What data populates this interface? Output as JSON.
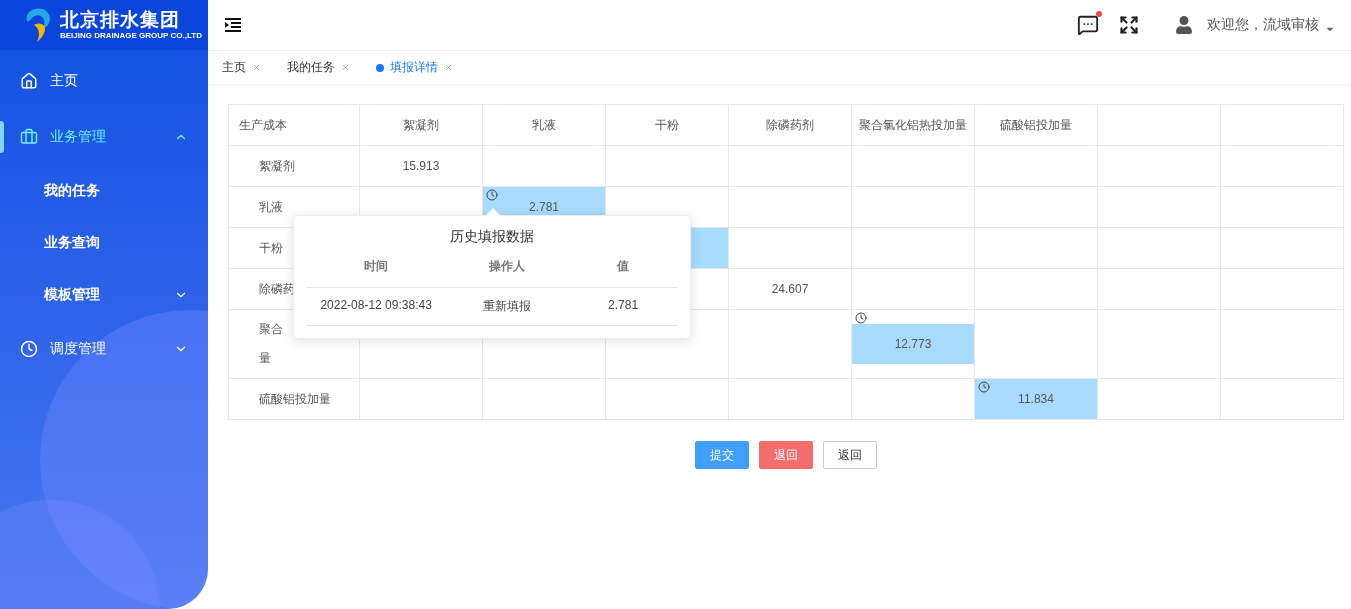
{
  "logo": {
    "name": "北京排水集团",
    "subtitle": "BEIJING DRAINAGE GROUP CO.,LTD"
  },
  "sidebar": {
    "items": [
      {
        "label": "主页",
        "kind": "home",
        "selected": false
      },
      {
        "label": "业务管理",
        "kind": "briefcase",
        "selected": true,
        "expanded": true,
        "children": [
          {
            "label": "我的任务",
            "selected": false
          },
          {
            "label": "业务查询",
            "selected": false
          },
          {
            "label": "模板管理",
            "selected": false,
            "expanded": false
          }
        ]
      },
      {
        "label": "调度管理",
        "kind": "clock",
        "selected": false,
        "expanded": false
      }
    ]
  },
  "header": {
    "user": "欢迎您，流域审核",
    "has_unread": true
  },
  "tabs": [
    {
      "label": "主页",
      "selected": false
    },
    {
      "label": "我的任务",
      "selected": false
    },
    {
      "label": "填报详情",
      "selected": true
    }
  ],
  "table": {
    "corner": "生产成本",
    "columns": [
      {
        "label": "絮凝剂"
      },
      {
        "label": "乳液"
      },
      {
        "label": "干粉"
      },
      {
        "label": "除磷药剂"
      },
      {
        "label": "聚合氯化铝热投加量"
      },
      {
        "label": "硫酸铝投加量"
      },
      {},
      {}
    ],
    "rows": [
      {
        "label": [
          "絮凝剂"
        ],
        "cells": [
          {
            "value": "15.913",
            "modified": false
          },
          {
            "modified": false
          },
          {
            "modified": false
          },
          {
            "modified": false
          },
          {
            "modified": false
          },
          {
            "modified": false
          },
          {
            "modified": false
          },
          {
            "modified": false
          }
        ]
      },
      {
        "label": [
          "乳液"
        ],
        "cells": [
          {
            "modified": false
          },
          {
            "value": "2.781",
            "modified": true
          },
          {
            "modified": false
          },
          {
            "modified": false
          },
          {
            "modified": false
          },
          {
            "modified": false
          },
          {
            "modified": false
          },
          {
            "modified": false
          }
        ]
      },
      {
        "label": [
          "干粉"
        ],
        "cells": [
          {},
          {},
          {
            "modified": true
          },
          {
            "modified": false
          },
          {
            "modified": false
          },
          {
            "modified": false
          },
          {
            "modified": false
          },
          {
            "modified": false
          }
        ]
      },
      {
        "label": [
          "除磷药"
        ],
        "cells": [
          {},
          {},
          {
            "modified": false
          },
          {
            "value": "24.607",
            "modified": false
          },
          {
            "modified": false
          },
          {
            "modified": false
          },
          {
            "modified": false
          },
          {
            "modified": false
          }
        ]
      },
      {
        "label": [
          "聚合",
          "量"
        ],
        "cells": [
          {
            "modified": false
          },
          {
            "modified": false
          },
          {
            "modified": false
          },
          {
            "modified": false
          },
          {
            "value": "12.773",
            "modified": true
          },
          {
            "modified": false
          },
          {
            "modified": false
          },
          {
            "modified": false
          }
        ]
      },
      {
        "label": [
          "硫酸铝投加量"
        ],
        "cells": [
          {
            "modified": false
          },
          {
            "modified": false
          },
          {
            "modified": false
          },
          {
            "modified": false
          },
          {
            "modified": false
          },
          {
            "value": "11.834",
            "modified": true
          },
          {
            "modified": false
          },
          {
            "modified": false
          }
        ]
      }
    ]
  },
  "popover": {
    "title": "历史填报数据",
    "columns": [
      "时间",
      "操作人",
      "值"
    ],
    "rows": [
      [
        "2022-08-12 09:38:43",
        "重新填报",
        "2.781"
      ]
    ]
  },
  "buttons": [
    {
      "label": "提交",
      "kind": "primary"
    },
    {
      "label": "退回",
      "kind": "danger"
    },
    {
      "label": "返回",
      "kind": "default"
    }
  ]
}
